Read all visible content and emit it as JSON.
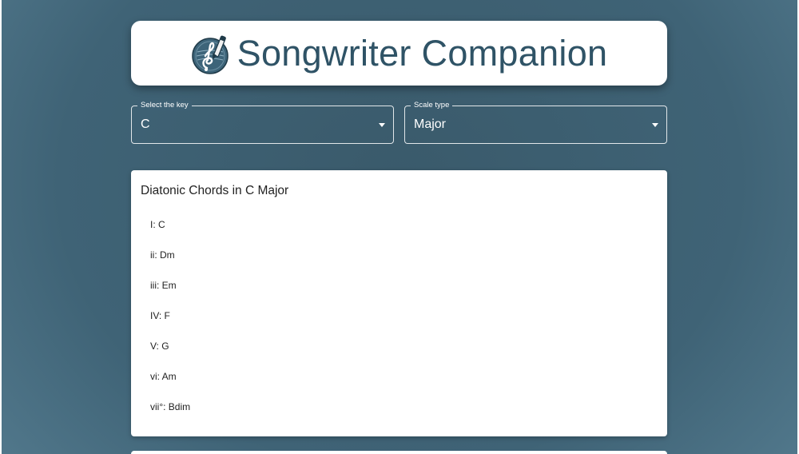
{
  "app": {
    "title": "Songwriter Companion",
    "logo_icon": "treble-clef-pen-icon"
  },
  "controls": {
    "key_select": {
      "label": "Select the key",
      "value": "C"
    },
    "scale_select": {
      "label": "Scale type",
      "value": "Major"
    }
  },
  "chords": {
    "title": "Diatonic Chords in C Major",
    "items": [
      "I: C",
      "ii: Dm",
      "iii: Em",
      "IV: F",
      "V: G",
      "vi: Am",
      "vii°: Bdim"
    ]
  },
  "colors": {
    "title_text": "#2f5366",
    "background": "#3f6376",
    "card": "#ffffff"
  }
}
